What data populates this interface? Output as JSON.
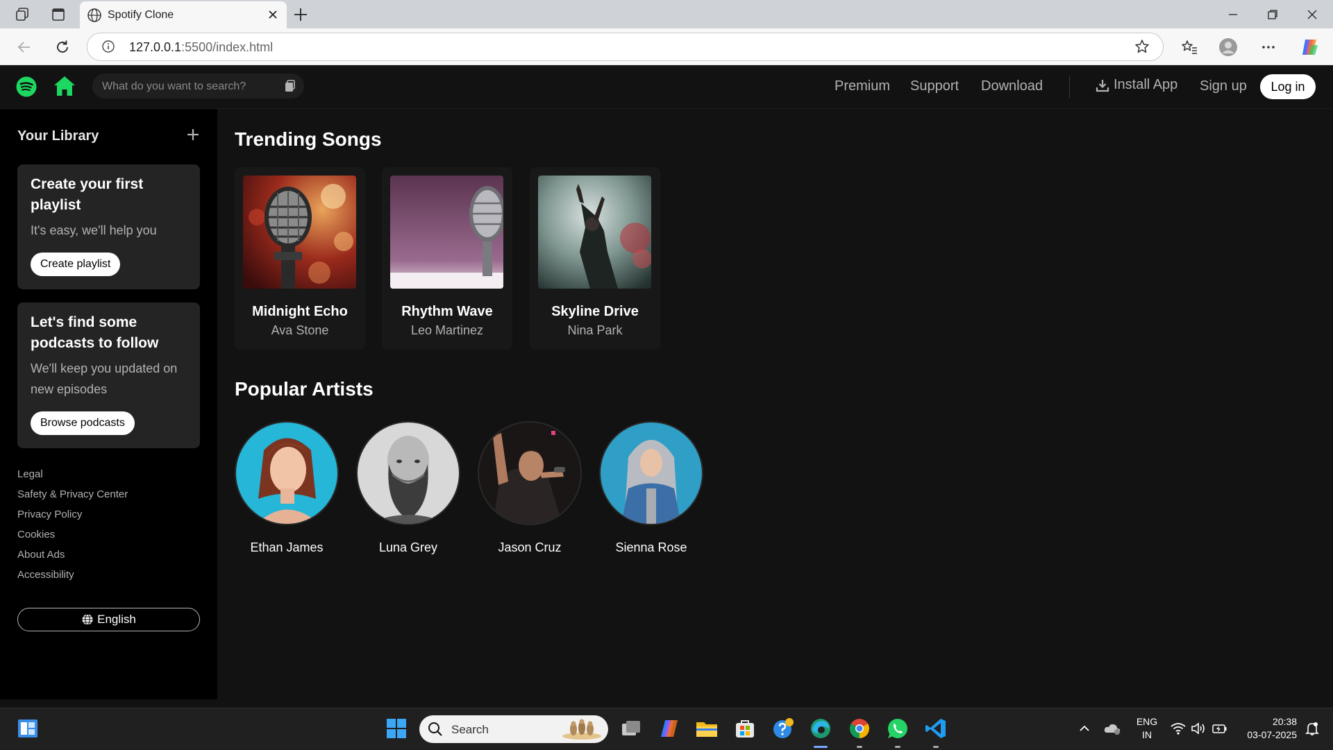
{
  "browser": {
    "tab_title": "Spotify Clone",
    "url_host": "127.0.0.1",
    "url_rest": ":5500/index.html"
  },
  "header": {
    "search_placeholder": "What do you want to search?",
    "nav": [
      "Premium",
      "Support",
      "Download"
    ],
    "install_label": "Install App",
    "signup_label": "Sign up",
    "login_label": "Log in",
    "brand_color": "#1ed760"
  },
  "sidebar": {
    "library_title": "Your Library",
    "playlist_card": {
      "title": "Create your first playlist",
      "subtitle": "It's easy, we'll help you",
      "button": "Create playlist"
    },
    "podcast_card": {
      "title": "Let's find some podcasts to follow",
      "subtitle": "We'll keep you updated on new episodes",
      "button": "Browse podcasts"
    },
    "footer_links": [
      "Legal",
      "Safety & Privacy Center",
      "Privacy Policy",
      "Cookies",
      "About Ads",
      "Accessibility"
    ],
    "language": "English"
  },
  "main": {
    "trending_title": "Trending Songs",
    "songs": [
      {
        "title": "Midnight Echo",
        "artist": "Ava Stone"
      },
      {
        "title": "Rhythm Wave",
        "artist": "Leo Martinez"
      },
      {
        "title": "Skyline Drive",
        "artist": "Nina Park"
      }
    ],
    "artists_title": "Popular Artists",
    "artists": [
      {
        "name": "Ethan James"
      },
      {
        "name": "Luna Grey"
      },
      {
        "name": "Jason Cruz"
      },
      {
        "name": "Sienna Rose"
      }
    ]
  },
  "taskbar": {
    "search_placeholder": "Search",
    "lang_line1": "ENG",
    "lang_line2": "IN",
    "time": "20:38",
    "date": "03-07-2025"
  }
}
